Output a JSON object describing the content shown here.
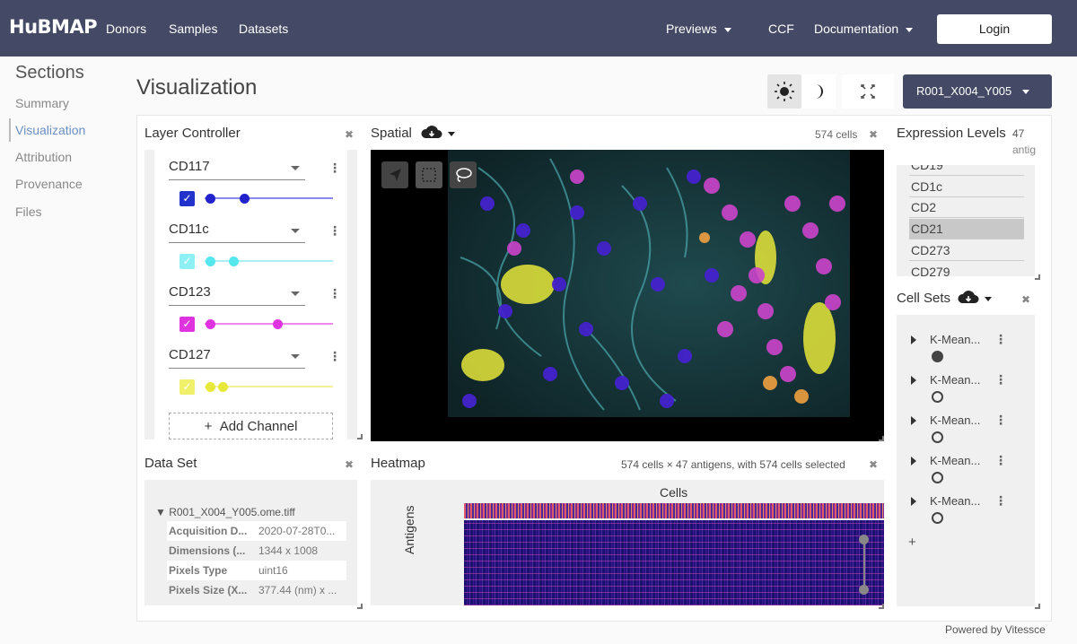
{
  "nav": {
    "logo": "HuBMAP",
    "links": [
      "Donors",
      "Samples",
      "Datasets"
    ],
    "right_links": {
      "previews": "Previews",
      "ccf": "CCF",
      "documentation": "Documentation"
    },
    "login": "Login"
  },
  "sidebar": {
    "title": "Sections",
    "items": [
      "Summary",
      "Visualization",
      "Attribution",
      "Provenance",
      "Files"
    ],
    "active": "Visualization"
  },
  "page": {
    "title": "Visualization",
    "dataset_button": "R001_X004_Y005"
  },
  "layer_controller": {
    "title": "Layer Controller",
    "channels": [
      {
        "name": "CD117",
        "color": "#3333dd",
        "checked": true,
        "range": [
          0.03,
          0.3
        ]
      },
      {
        "name": "CD11c",
        "color": "#55e6ee",
        "checked": true,
        "range": [
          0.03,
          0.22
        ]
      },
      {
        "name": "CD123",
        "color": "#e033e0",
        "checked": true,
        "range": [
          0.03,
          0.57
        ]
      },
      {
        "name": "CD127",
        "color": "#e8e83a",
        "checked": true,
        "range": [
          0.03,
          0.14
        ]
      }
    ],
    "add_channel": "Add Channel"
  },
  "spatial": {
    "title": "Spatial",
    "cell_count": "574 cells"
  },
  "expression": {
    "title": "Expression Levels",
    "count_fragment_1": "47",
    "count_fragment_2": "antig",
    "items": [
      "CD19",
      "CD1c",
      "CD2",
      "CD21",
      "CD273",
      "CD279"
    ],
    "selected": "CD21"
  },
  "cell_sets": {
    "title": "Cell Sets",
    "items": [
      {
        "label": "K-Mean...",
        "filled": true
      },
      {
        "label": "K-Mean...",
        "filled": false
      },
      {
        "label": "K-Mean...",
        "filled": false
      },
      {
        "label": "K-Mean...",
        "filled": false
      },
      {
        "label": "K-Mean...",
        "filled": false
      }
    ],
    "add": "+"
  },
  "dataset": {
    "title": "Data Set",
    "file": "R001_X004_Y005.ome.tiff",
    "rows": [
      {
        "k": "Acquisition D...",
        "v": "2020-07-28T0..."
      },
      {
        "k": "Dimensions (...",
        "v": "1344 x 1008"
      },
      {
        "k": "Pixels Type",
        "v": "uint16"
      },
      {
        "k": "Pixels Size (X...",
        "v": "377.44 (nm) x ..."
      }
    ]
  },
  "heatmap": {
    "title": "Heatmap",
    "summary": "574 cells × 47 antigens, with 574 cells selected",
    "x_label": "Cells",
    "y_label": "Antigens"
  },
  "footer": {
    "powered": "Powered by Vitessce"
  }
}
